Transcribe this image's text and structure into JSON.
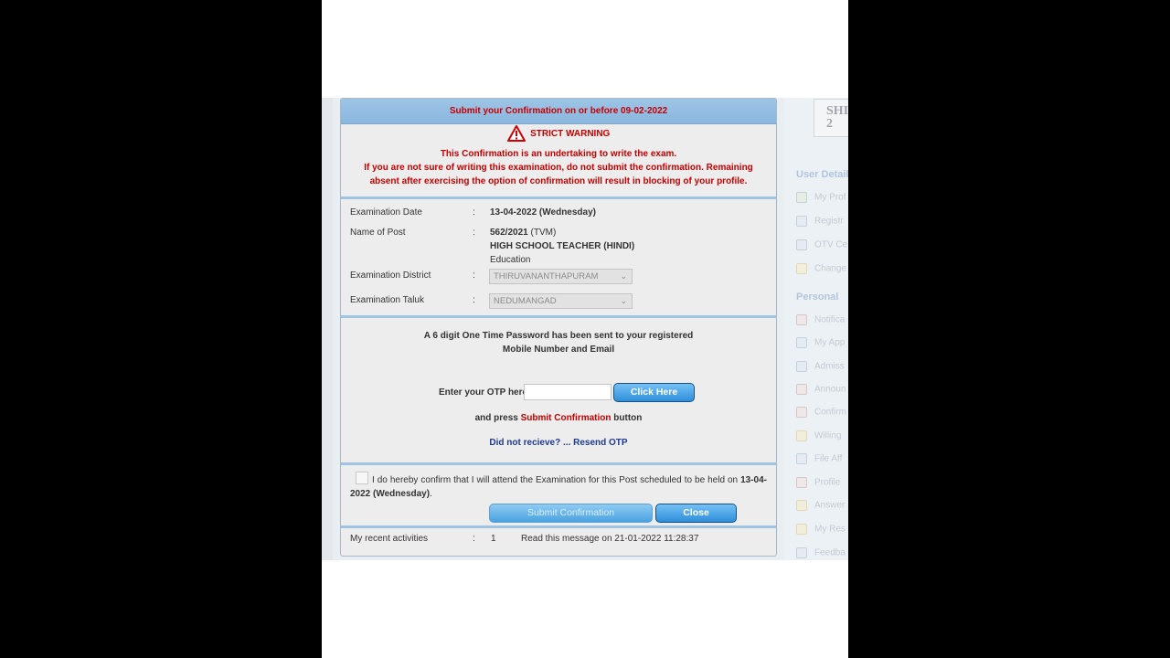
{
  "sidebar": {
    "logo_text": "SHI 2",
    "section_user": "User Detail",
    "section_personal": "Personal",
    "user_items": [
      "My Prof",
      "Registr",
      "OTV Ce",
      "Change"
    ],
    "personal_items": [
      "Notifica",
      "My App",
      "Admiss",
      "Announ",
      "Confirm",
      "Willing",
      "File Aff",
      "Profile",
      "Answer",
      "My Res",
      "Feedba"
    ]
  },
  "dialog": {
    "header": "Submit your Confirmation on or before 09-02-2022",
    "warning_title": "STRICT WARNING",
    "warning_line1": "This Confirmation is an undertaking to write the exam.",
    "warning_line2": "If you are not sure of writing this examination, do not submit the confirmation. Remaining absent after exercising the option of confirmation will result in blocking of your profile.",
    "details": {
      "exam_date_label": "Examination Date",
      "exam_date_value": "13-04-2022 (Wednesday)",
      "post_label": "Name of Post",
      "post_code": "562/2021",
      "post_region": "(TVM)",
      "post_name": "HIGH SCHOOL TEACHER (HINDI)",
      "post_dept": "Education",
      "district_label": "Examination District",
      "district_value": "THIRUVANANTHAPURAM",
      "taluk_label": "Examination Taluk",
      "taluk_value": "NEDUMANGAD",
      "colon": ":"
    },
    "otp": {
      "message_line1": "A 6 digit One Time Password has been sent to your registered",
      "message_line2": "Mobile Number and Email",
      "label": "Enter your OTP here",
      "input_value": "",
      "click_here": "Click Here",
      "press_prefix": "and press",
      "press_link": "Submit Confirmation",
      "press_suffix": "button",
      "resend": "Did not recieve? ... Resend OTP"
    },
    "confirm": {
      "text_prefix": "I do hereby confirm that I will attend the Examination for this Post scheduled to be held on",
      "text_date": "13-04-2022 (Wednesday)",
      "text_suffix": ".",
      "checked": false,
      "submit_label": "Submit Confirmation",
      "close_label": "Close"
    },
    "recent": {
      "label": "My recent activities",
      "colon": ":",
      "count": "1",
      "message": "Read this message on 21-01-2022 11:28:37"
    }
  },
  "colors": {
    "warning_red": "#c40000",
    "header_blue": "#8bb7de",
    "button_blue": "#2f8fdb",
    "link_navy": "#1f3a93"
  }
}
